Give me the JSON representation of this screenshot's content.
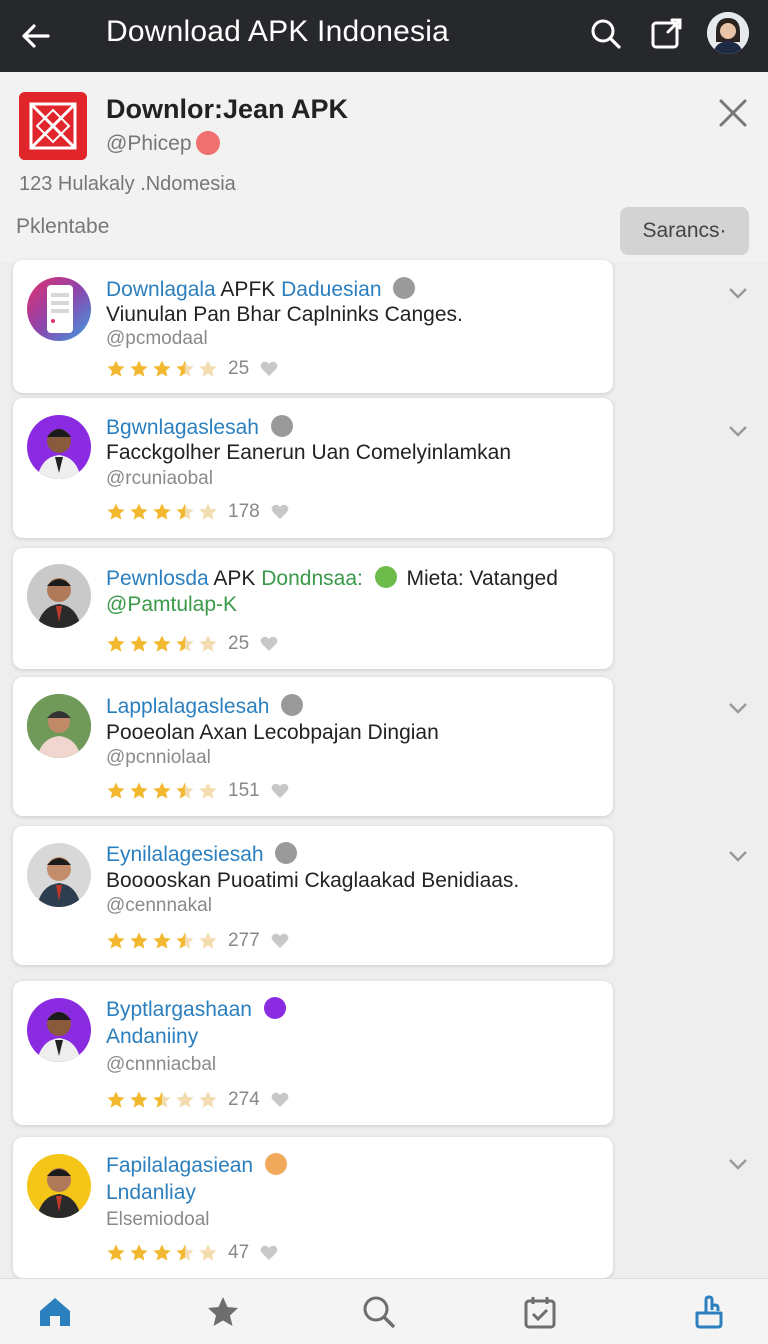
{
  "topbar": {
    "title": "Download APK Indonesia"
  },
  "header": {
    "app_name": "Downlor:Jean APK",
    "handle": "@Phicep",
    "subtitle": "123 Hulakaly .Ndomesia",
    "section_label": "Pklentabe",
    "sort_button": "Sarancs·"
  },
  "items": [
    {
      "title_blue": "Downlagala",
      "title_rest": " APFK ",
      "title_blue2": "Daduesian",
      "line2": "Viunulan Pan Bhar Caplninks Canges.",
      "handle": "@pcmodaal",
      "stars": 3.5,
      "count": "25"
    },
    {
      "title_blue": "Bgwnlagaslesah",
      "line2": "Facckgolher Eanerun Uan Comelyinlamkan",
      "handle": "@rcuniaobal",
      "stars": 3.5,
      "count": "178"
    },
    {
      "title_blue": "Pewnlosda",
      "title_rest": " APK ",
      "title_green": "Dondnsaa:",
      "title_rest2": " Mieta: Vatanged",
      "line2": "@Pamtulap-K",
      "stars": 3.5,
      "count": "25"
    },
    {
      "title_blue": "Lapplalagaslesah",
      "line2": "Pooeolan Axan Lecobpajan Dingian",
      "handle": "@pcnniolaal",
      "stars": 3.5,
      "count": "151"
    },
    {
      "title_blue": "Eynilalagesiesah",
      "line2": "Booooskan Puoatimi Ckaglaakad Benidiaas.",
      "handle": "@cennnakal",
      "stars": 3.5,
      "count": "277"
    },
    {
      "title_blue": "Byptlargashaan",
      "line2": "Andaniiny",
      "handle": "@cnnniacbal",
      "stars": 2.5,
      "count": "274"
    },
    {
      "title_blue": "Fapilalagasiean",
      "line2": "Lndanliay",
      "handle": "Elsemiodoal",
      "stars": 3.5,
      "count": "47"
    }
  ],
  "bottom_nav": [
    "home-icon",
    "star-icon",
    "search-icon",
    "calendar-check-icon",
    "touch-icon"
  ],
  "colors": {
    "accent": "#2b7fbe",
    "star": "#f2b930",
    "topbar": "#26282b",
    "logo": "#e0262b"
  }
}
